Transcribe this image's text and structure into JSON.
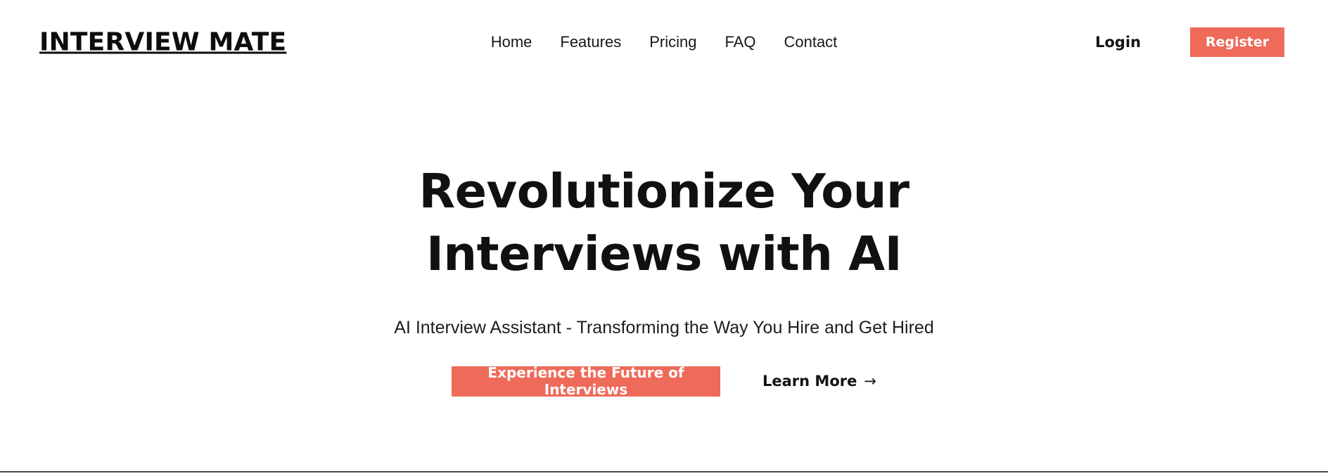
{
  "header": {
    "brand": "INTERVIEW MATE",
    "nav": [
      {
        "label": "Home"
      },
      {
        "label": "Features"
      },
      {
        "label": "Pricing"
      },
      {
        "label": "FAQ"
      },
      {
        "label": "Contact"
      }
    ],
    "login_label": "Login",
    "register_label": "Register"
  },
  "hero": {
    "title": "Revolutionize Your Interviews with AI",
    "subtitle": "AI Interview Assistant - Transforming the Way You Hire and Get Hired",
    "cta_primary_label": "Experience the Future of Interviews",
    "cta_secondary_label": "Learn More",
    "cta_secondary_arrow": "→"
  },
  "colors": {
    "accent": "#ee6a59",
    "text": "#111111",
    "background": "#ffffff",
    "divider": "#454a57"
  }
}
